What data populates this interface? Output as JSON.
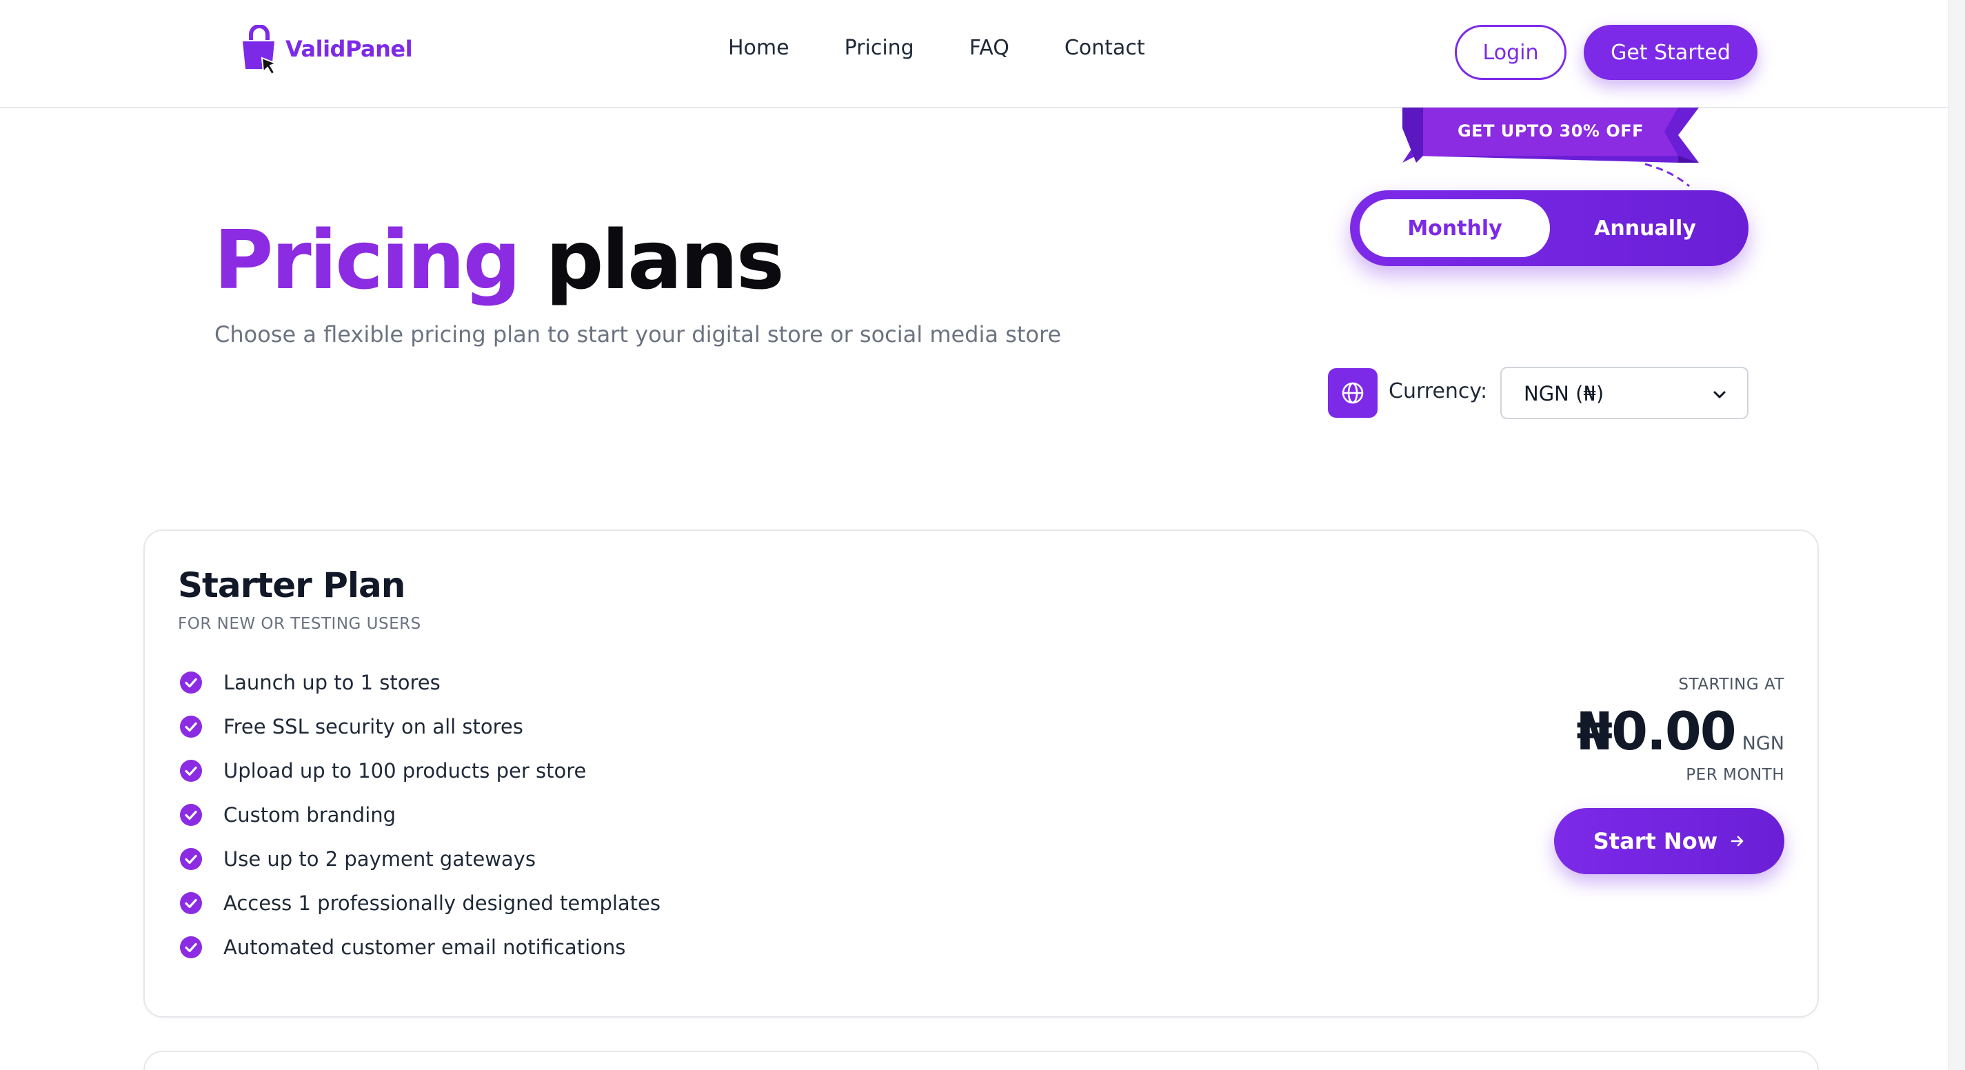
{
  "brand": {
    "name": "ValidPanel",
    "color": "#7c2ae8"
  },
  "nav": {
    "items": [
      "Home",
      "Pricing",
      "FAQ",
      "Contact"
    ]
  },
  "header": {
    "login_label": "Login",
    "get_started_label": "Get Started"
  },
  "hero": {
    "title_accent": "Pricing",
    "title_rest": "plans",
    "subtitle": "Choose a flexible pricing plan to start your digital store or social media store"
  },
  "promo": {
    "ribbon_text": "GET UPTO 30% OFF"
  },
  "billing_toggle": {
    "monthly": "Monthly",
    "annually": "Annually",
    "selected": "Monthly"
  },
  "currency": {
    "label": "Currency:",
    "selected": "NGN (₦)",
    "icon": "globe-icon"
  },
  "plans": [
    {
      "title": "Starter Plan",
      "tagline": "FOR NEW OR TESTING USERS",
      "features": [
        "Launch up to 1 stores",
        "Free SSL security on all stores",
        "Upload up to 100 products per store",
        "Custom branding",
        "Use up to 2 payment gateways",
        "Access 1 professionally designed templates",
        "Automated customer email notifications"
      ],
      "starting_at": "STARTING AT",
      "price": "₦0.00",
      "price_currency": "NGN",
      "period": "PER MONTH",
      "cta": "Start Now"
    }
  ]
}
